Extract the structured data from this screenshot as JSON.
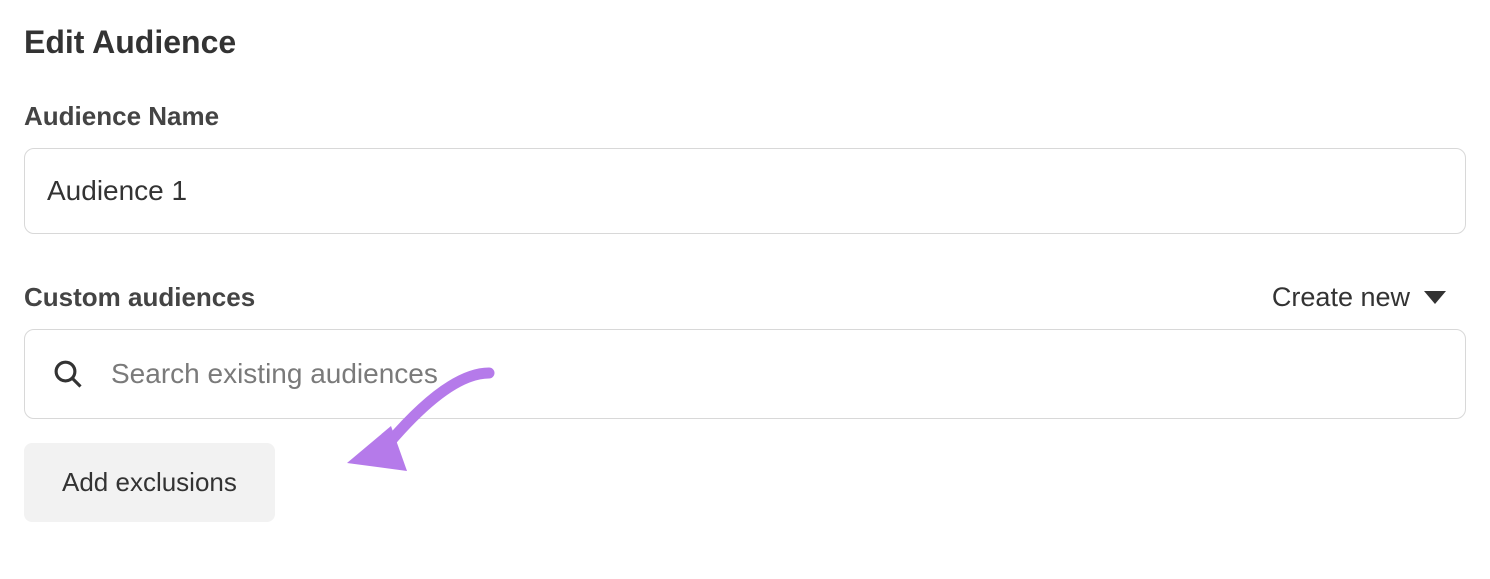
{
  "header": {
    "title": "Edit Audience"
  },
  "audience_name": {
    "label": "Audience Name",
    "value": "Audience 1"
  },
  "custom_audiences": {
    "label": "Custom audiences",
    "create_new_label": "Create new",
    "search_placeholder": "Search existing audiences",
    "add_exclusions_label": "Add exclusions"
  },
  "colors": {
    "annotation": "#b57aea"
  }
}
